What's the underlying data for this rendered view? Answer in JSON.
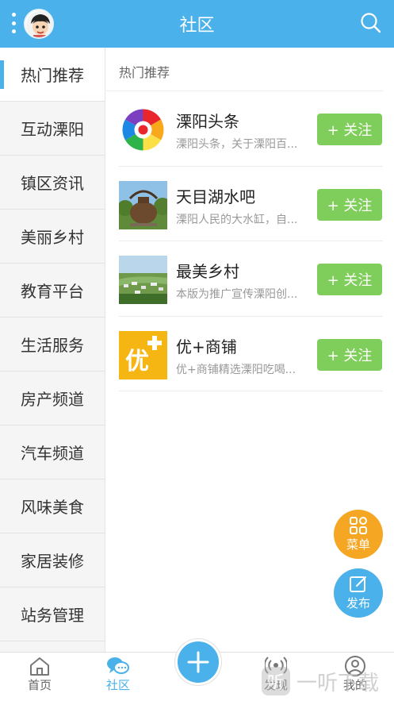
{
  "header": {
    "title": "社区",
    "colors": {
      "primary": "#4bb1ea"
    }
  },
  "sidebar": {
    "items": [
      {
        "label": "热门推荐",
        "active": true
      },
      {
        "label": "互动溧阳"
      },
      {
        "label": "镇区资讯"
      },
      {
        "label": "美丽乡村"
      },
      {
        "label": "教育平台"
      },
      {
        "label": "生活服务"
      },
      {
        "label": "房产频道"
      },
      {
        "label": "汽车频道"
      },
      {
        "label": "风味美食"
      },
      {
        "label": "家居装修"
      },
      {
        "label": "站务管理"
      }
    ]
  },
  "main": {
    "section_title": "热门推荐",
    "follow_label": "+ 关注",
    "items": [
      {
        "title": "溧阳头条",
        "desc": "溧阳头条，关于溧阳百...",
        "icon": "pinwheel-logo"
      },
      {
        "title": "天目湖水吧",
        "desc": "溧阳人民的大水缸，自...",
        "icon": "teapot-photo"
      },
      {
        "title": "最美乡村",
        "desc": "本版为推广宣传溧阳创...",
        "icon": "village-photo"
      },
      {
        "title": "优+商铺",
        "desc": "优+商铺精选溧阳吃喝...",
        "icon": "you-plus-logo"
      }
    ],
    "you_logo_text": "优"
  },
  "fabs": {
    "menu_label": "菜单",
    "post_label": "发布"
  },
  "bottom_nav": {
    "home": "首页",
    "community": "社区",
    "discover": "发现",
    "mine": "我的"
  },
  "watermark": {
    "text": "一听下载",
    "logo": "听"
  }
}
